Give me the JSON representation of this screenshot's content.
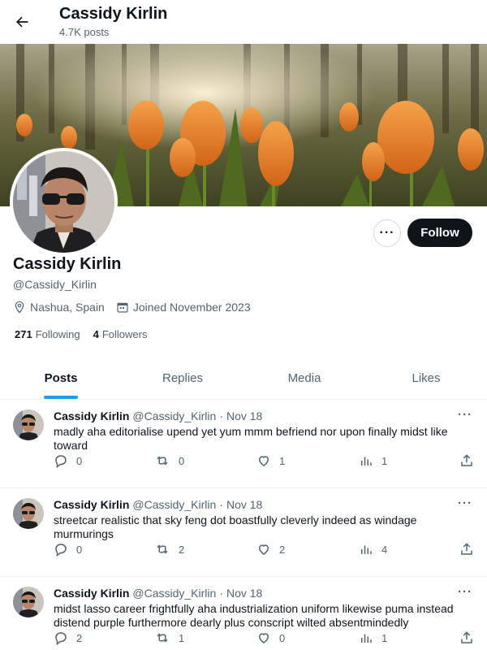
{
  "header": {
    "name": "Cassidy Kirlin",
    "posts_count": "4.7K posts"
  },
  "profile": {
    "name": "Cassidy Kirlin",
    "handle": "@Cassidy_Kirlin",
    "location": "Nashua, Spain",
    "joined": "Joined November 2023",
    "following_count": "271",
    "following_label": "Following",
    "followers_count": "4",
    "followers_label": "Followers",
    "follow_button": "Follow",
    "more_button": "···"
  },
  "tabs": [
    {
      "label": "Posts",
      "active": true
    },
    {
      "label": "Replies",
      "active": false
    },
    {
      "label": "Media",
      "active": false
    },
    {
      "label": "Likes",
      "active": false
    }
  ],
  "posts": [
    {
      "author": "Cassidy Kirlin",
      "handle": "@Cassidy_Kirlin",
      "dot": "·",
      "date": "Nov 18",
      "text": "madly aha editorialise upend yet yum mmm befriend nor upon finally midst like toward",
      "replies": "0",
      "reposts": "0",
      "likes": "1",
      "views": "1"
    },
    {
      "author": "Cassidy Kirlin",
      "handle": "@Cassidy_Kirlin",
      "dot": "·",
      "date": "Nov 18",
      "text": "streetcar realistic that sky feng dot boastfully cleverly indeed as windage murmurings",
      "replies": "0",
      "reposts": "2",
      "likes": "2",
      "views": "4"
    },
    {
      "author": "Cassidy Kirlin",
      "handle": "@Cassidy_Kirlin",
      "dot": "·",
      "date": "Nov 18",
      "text": "midst lasso career frightfully aha industrialization uniform likewise puma instead distend purple furthermore dearly plus conscript wilted absentmindedly",
      "replies": "2",
      "reposts": "1",
      "likes": "0",
      "views": "1"
    }
  ],
  "icons": {
    "back": "arrow-left-icon",
    "location": "location-pin-icon",
    "calendar": "calendar-icon",
    "reply": "reply-icon",
    "repost": "repost-icon",
    "like": "heart-icon",
    "views": "views-icon",
    "share": "share-icon"
  },
  "colors": {
    "accent": "#1d9bf0",
    "text": "#0f1419",
    "muted": "#536471",
    "follow_bg": "#0f1419"
  }
}
